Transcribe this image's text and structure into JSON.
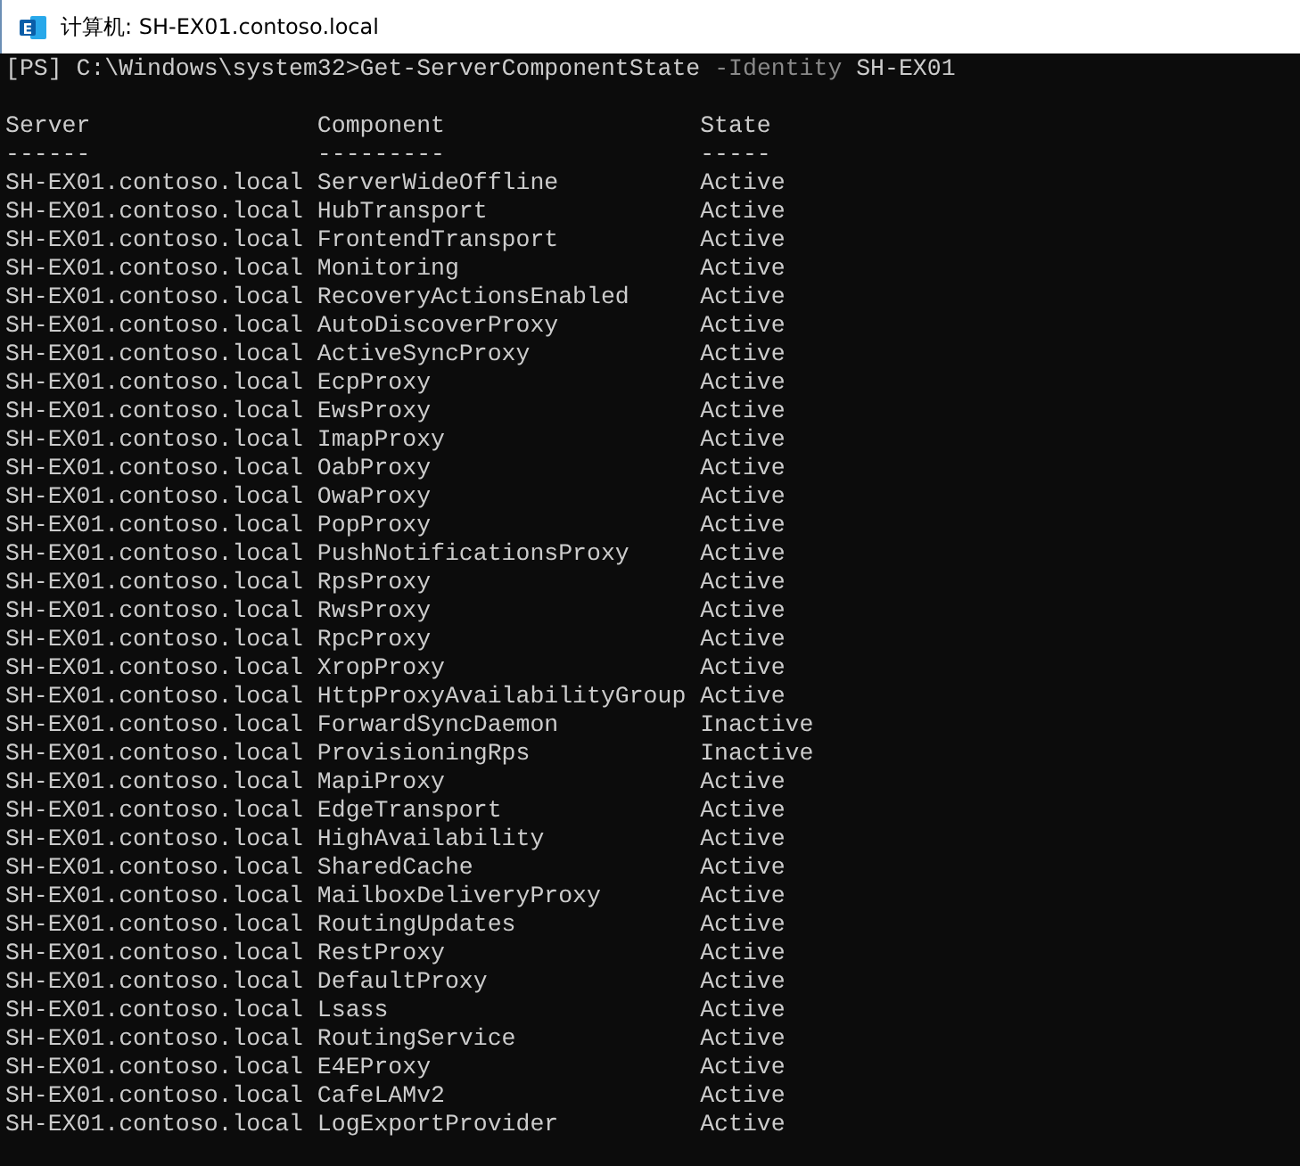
{
  "window": {
    "title": "计算机: SH-EX01.contoso.local"
  },
  "console": {
    "prompt": "[PS] C:\\Windows\\system32>",
    "command": {
      "cmdlet": "Get-ServerComponentState",
      "parameter": "-Identity",
      "value": "SH-EX01"
    },
    "columns": [
      {
        "label": "Server",
        "underline": "------"
      },
      {
        "label": "Component",
        "underline": "---------"
      },
      {
        "label": "State",
        "underline": "-----"
      }
    ],
    "rows": [
      [
        "SH-EX01.contoso.local",
        "ServerWideOffline",
        "Active"
      ],
      [
        "SH-EX01.contoso.local",
        "HubTransport",
        "Active"
      ],
      [
        "SH-EX01.contoso.local",
        "FrontendTransport",
        "Active"
      ],
      [
        "SH-EX01.contoso.local",
        "Monitoring",
        "Active"
      ],
      [
        "SH-EX01.contoso.local",
        "RecoveryActionsEnabled",
        "Active"
      ],
      [
        "SH-EX01.contoso.local",
        "AutoDiscoverProxy",
        "Active"
      ],
      [
        "SH-EX01.contoso.local",
        "ActiveSyncProxy",
        "Active"
      ],
      [
        "SH-EX01.contoso.local",
        "EcpProxy",
        "Active"
      ],
      [
        "SH-EX01.contoso.local",
        "EwsProxy",
        "Active"
      ],
      [
        "SH-EX01.contoso.local",
        "ImapProxy",
        "Active"
      ],
      [
        "SH-EX01.contoso.local",
        "OabProxy",
        "Active"
      ],
      [
        "SH-EX01.contoso.local",
        "OwaProxy",
        "Active"
      ],
      [
        "SH-EX01.contoso.local",
        "PopProxy",
        "Active"
      ],
      [
        "SH-EX01.contoso.local",
        "PushNotificationsProxy",
        "Active"
      ],
      [
        "SH-EX01.contoso.local",
        "RpsProxy",
        "Active"
      ],
      [
        "SH-EX01.contoso.local",
        "RwsProxy",
        "Active"
      ],
      [
        "SH-EX01.contoso.local",
        "RpcProxy",
        "Active"
      ],
      [
        "SH-EX01.contoso.local",
        "XropProxy",
        "Active"
      ],
      [
        "SH-EX01.contoso.local",
        "HttpProxyAvailabilityGroup",
        "Active"
      ],
      [
        "SH-EX01.contoso.local",
        "ForwardSyncDaemon",
        "Inactive"
      ],
      [
        "SH-EX01.contoso.local",
        "ProvisioningRps",
        "Inactive"
      ],
      [
        "SH-EX01.contoso.local",
        "MapiProxy",
        "Active"
      ],
      [
        "SH-EX01.contoso.local",
        "EdgeTransport",
        "Active"
      ],
      [
        "SH-EX01.contoso.local",
        "HighAvailability",
        "Active"
      ],
      [
        "SH-EX01.contoso.local",
        "SharedCache",
        "Active"
      ],
      [
        "SH-EX01.contoso.local",
        "MailboxDeliveryProxy",
        "Active"
      ],
      [
        "SH-EX01.contoso.local",
        "RoutingUpdates",
        "Active"
      ],
      [
        "SH-EX01.contoso.local",
        "RestProxy",
        "Active"
      ],
      [
        "SH-EX01.contoso.local",
        "DefaultProxy",
        "Active"
      ],
      [
        "SH-EX01.contoso.local",
        "Lsass",
        "Active"
      ],
      [
        "SH-EX01.contoso.local",
        "RoutingService",
        "Active"
      ],
      [
        "SH-EX01.contoso.local",
        "E4EProxy",
        "Active"
      ],
      [
        "SH-EX01.contoso.local",
        "CafeLAMv2",
        "Active"
      ],
      [
        "SH-EX01.contoso.local",
        "LogExportProvider",
        "Active"
      ]
    ]
  }
}
